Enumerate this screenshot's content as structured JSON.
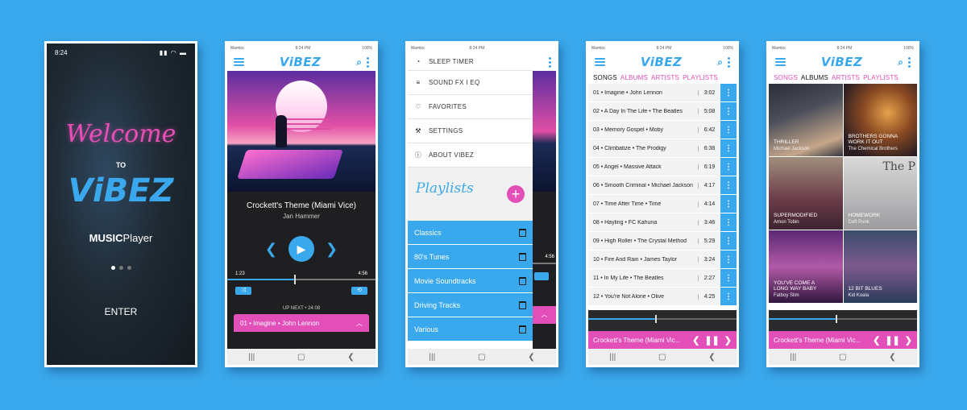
{
  "colors": {
    "background": "#3aa8ec",
    "accent_blue": "#3aa8ec",
    "accent_pink": "#e24fb9",
    "dark": "#1f1f21"
  },
  "screen1": {
    "time": "8:24",
    "welcome": "Welcome",
    "to": "TO",
    "logo": "ViBEZ",
    "music_bold": "MUSIC",
    "music_rest": "Player",
    "enter": "ENTER"
  },
  "statusbar": {
    "carrier": "Mambo",
    "time": "8:24 PM",
    "battery": "100%"
  },
  "header": {
    "logo": "ViBEZ"
  },
  "screen2": {
    "track_title": "Crockett's Theme (Miami Vice)",
    "artist": "Jan Hammer",
    "elapsed": "1:23",
    "total": "4:56",
    "progress": 0.45,
    "up_next_label": "UP NEXT • 24:08",
    "up_next_track": "01 • Imagine • John Lennon"
  },
  "screen3": {
    "menu": [
      {
        "icon": "timer-icon",
        "glyph": "◔",
        "label": "SLEEP TIMER"
      },
      {
        "icon": "equalizer-icon",
        "glyph": "≡",
        "label": "SOUND FX I EQ"
      },
      {
        "icon": "heart-icon",
        "glyph": "♡",
        "label": "FAVORITES"
      },
      {
        "icon": "wrench-icon",
        "glyph": "⚒",
        "label": "SETTINGS"
      },
      {
        "icon": "info-icon",
        "glyph": "ⓘ",
        "label": "ABOUT VIBEZ"
      }
    ],
    "playlists_title": "Playlists",
    "playlists": [
      "Classics",
      "80's Tunes",
      "Movie Soundtracks",
      "Driving Tracks",
      "Various"
    ],
    "right_time": "4:56"
  },
  "tabs": [
    "SONGS",
    "ALBUMS",
    "ARTISTS",
    "PLAYLISTS"
  ],
  "screen4": {
    "songs": [
      {
        "title": "01 • Imagine • John Lennon",
        "duration": "3:02"
      },
      {
        "title": "02 • A Day In The Life • The Beatles",
        "duration": "5:08"
      },
      {
        "title": "03 • Memory Gospel • Moby",
        "duration": "6:42"
      },
      {
        "title": "04 • Climbatize • The Prodigy",
        "duration": "6:38"
      },
      {
        "title": "05 • Angel • Massive Attack",
        "duration": "6:19"
      },
      {
        "title": "06 • Smooth Criminal • Michael Jackson",
        "duration": "4:17"
      },
      {
        "title": "07 • Time After Time • Time",
        "duration": "4:14"
      },
      {
        "title": "08 • Hayling • FC Kahuna",
        "duration": "3:46"
      },
      {
        "title": "09 • High Roller • The Crystal Method",
        "duration": "5:29"
      },
      {
        "title": "10 • Fire And Rain • James Taylor",
        "duration": "3:24"
      },
      {
        "title": "11 • In My Life • The Beatles",
        "duration": "2:27"
      },
      {
        "title": "12 • You're Not Alone • Olive",
        "duration": "4:25"
      }
    ],
    "now_playing": "Crockett's Theme (Miami Vic...",
    "progress": 0.45
  },
  "screen5": {
    "albums": [
      {
        "title": "THRILLER",
        "artist": "Michael Jackson"
      },
      {
        "title": "BROTHERS GONNA WORK IT OUT",
        "artist": "The Chemical Brothers"
      },
      {
        "title": "SUPERMODIFIED",
        "artist": "Amon Tobin"
      },
      {
        "title": "HOMEWORK",
        "artist": "Daft Punk"
      },
      {
        "title": "YOU'VE COME A LONG WAY BABY",
        "artist": "Fatboy Slim"
      },
      {
        "title": "12 BIT BLUES",
        "artist": "Kid Koala"
      }
    ],
    "tile_text": "The P",
    "now_playing": "Crockett's Theme (Miami Vic...",
    "progress": 0.45
  }
}
